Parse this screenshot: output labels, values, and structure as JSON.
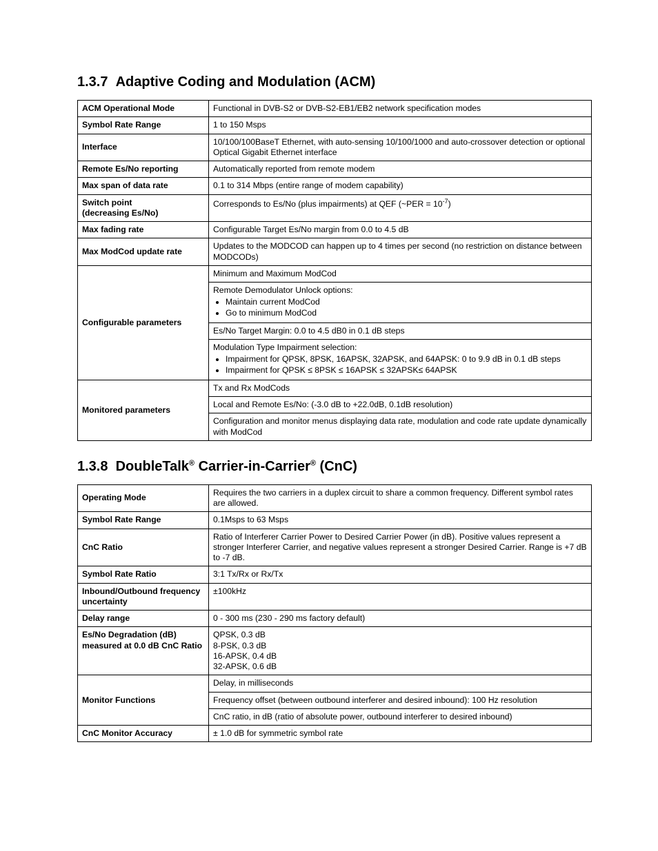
{
  "section1": {
    "heading_num": "1.3.7",
    "heading_text": "Adaptive Coding and Modulation (ACM)",
    "rows": [
      {
        "label": "ACM Operational Mode",
        "value": "Functional in DVB-S2 or DVB-S2-EB1/EB2 network specification modes"
      },
      {
        "label": "Symbol Rate Range",
        "value": "1 to 150 Msps"
      },
      {
        "label": "Interface",
        "value": "10/100/100BaseT Ethernet, with auto-sensing 10/100/1000 and auto-crossover detection or optional Optical Gigabit Ethernet interface"
      },
      {
        "label": "Remote Es/No reporting",
        "value": "Automatically reported from remote modem"
      },
      {
        "label": "Max span of data rate",
        "value": "0.1 to 314 Mbps (entire range of modem capability)"
      }
    ],
    "switch_point": {
      "label1": "Switch point",
      "label2": "(decreasing Es/No)",
      "value_pre": "Corresponds to Es/No (plus impairments) at QEF (~PER = 10",
      "value_sup": "-7",
      "value_post": ")"
    },
    "rows2": [
      {
        "label": "Max fading rate",
        "value": "Configurable Target Es/No margin from 0.0 to 4.5 dB"
      },
      {
        "label": "Max ModCod update rate",
        "value": "Updates to the MODCOD can happen up to 4 times per second (no restriction on distance between MODCODs)"
      }
    ],
    "config": {
      "label": "Configurable parameters",
      "cell1": "Minimum and Maximum ModCod",
      "cell2_intro": "Remote Demodulator Unlock options:",
      "cell2_items": [
        "Maintain current ModCod",
        "Go to minimum ModCod"
      ],
      "cell3": "Es/No Target Margin: 0.0 to 4.5 dB0 in 0.1 dB steps",
      "cell4_intro": "Modulation Type Impairment selection:",
      "cell4_items": [
        "Impairment for QPSK, 8PSK, 16APSK, 32APSK, and 64APSK: 0 to 9.9 dB in 0.1 dB steps",
        "Impairment for QPSK ≤ 8PSK ≤ 16APSK ≤ 32APSK≤ 64APSK"
      ]
    },
    "monitor": {
      "label": "Monitored parameters",
      "cell1": "Tx and Rx ModCods",
      "cell2": "Local and Remote Es/No: (-3.0 dB to +22.0dB, 0.1dB resolution)",
      "cell3": "Configuration and monitor menus displaying data rate, modulation and code rate update dynamically with ModCod"
    }
  },
  "section2": {
    "heading_num": "1.3.8",
    "heading_pre": "DoubleTalk",
    "heading_mid": " Carrier-in-Carrier",
    "heading_post": " (CnC)",
    "rows": [
      {
        "label": "Operating Mode",
        "value": "Requires the two carriers in a duplex circuit to share a common frequency. Different symbol rates are allowed."
      },
      {
        "label": "Symbol Rate Range",
        "value": "0.1Msps to 63 Msps"
      },
      {
        "label": "CnC Ratio",
        "value": "Ratio of Interferer Carrier Power to Desired Carrier Power (in dB). Positive values represent a stronger Interferer Carrier, and negative values represent a stronger Desired Carrier. Range is +7 dB to -7 dB."
      },
      {
        "label": "Symbol Rate Ratio",
        "value": "3:1 Tx/Rx or Rx/Tx"
      },
      {
        "label": "Inbound/Outbound frequency uncertainty",
        "value": "±100kHz"
      },
      {
        "label": "Delay range",
        "value": "0 - 300 ms (230 - 290 ms factory default)"
      }
    ],
    "degradation": {
      "label": "Es/No Degradation (dB) measured at 0.0 dB CnC Ratio",
      "lines": [
        "QPSK, 0.3 dB",
        "8-PSK, 0.3 dB",
        "16-APSK, 0.4 dB",
        "32-APSK, 0.6 dB"
      ]
    },
    "monfunc": {
      "label": "Monitor Functions",
      "cell1": "Delay, in milliseconds",
      "cell2": "Frequency offset (between outbound interferer and desired inbound): 100 Hz resolution",
      "cell3": "CnC ratio, in dB (ratio of absolute power, outbound interferer to desired inbound)"
    },
    "accuracy": {
      "label": "CnC Monitor Accuracy",
      "value": "± 1.0 dB for symmetric symbol rate"
    }
  }
}
